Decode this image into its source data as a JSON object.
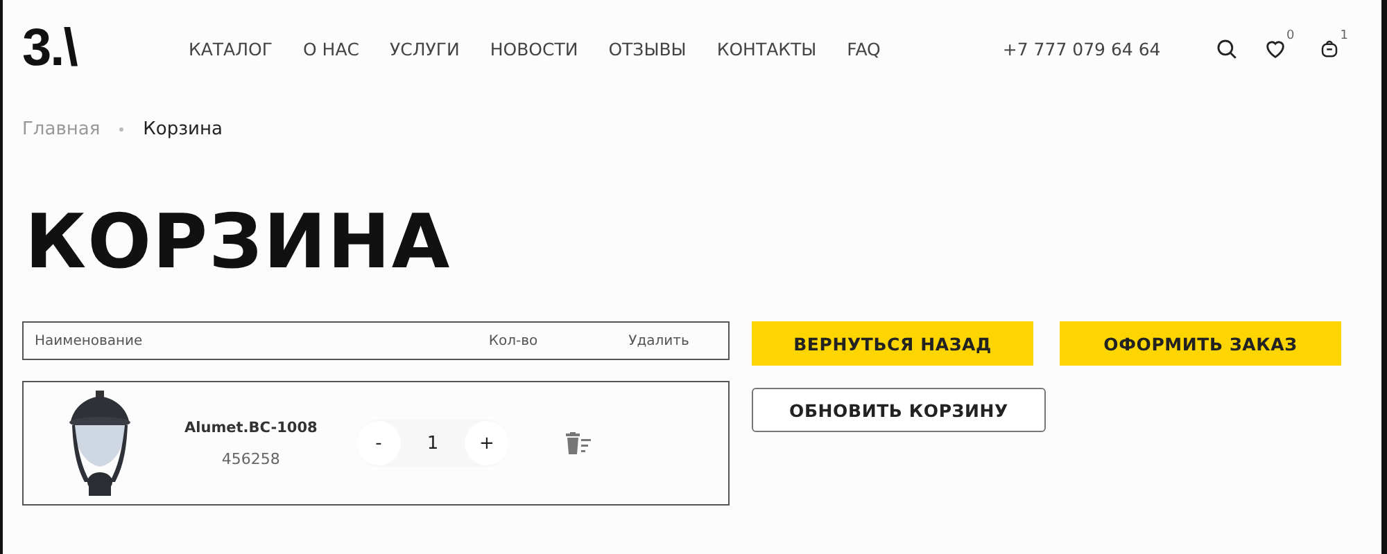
{
  "header": {
    "logo": "3.\\",
    "nav": [
      "КАТАЛОГ",
      "О НАС",
      "УСЛУГИ",
      "НОВОСТИ",
      "ОТЗЫВЫ",
      "КОНТАКТЫ",
      "FAQ"
    ],
    "phone": "+7 777 079 64 64",
    "favorites_count": "0",
    "cart_count": "1"
  },
  "breadcrumbs": [
    "Главная",
    "Корзина"
  ],
  "title": "КОРЗИНА",
  "table": {
    "columns": [
      "Наименование",
      "Кол-во",
      "Удалить"
    ],
    "rows": [
      {
        "name": "Alumet.BC-1008",
        "sku": "456258",
        "minus": "-",
        "quantity": "1",
        "plus": "+"
      }
    ]
  },
  "buttons": [
    {
      "label": "ВЕРНУТЬСЯ НАЗАД",
      "kind": "primary"
    },
    {
      "label": "ОФОРМИТЬ ЗАКАЗ",
      "kind": "primary"
    },
    {
      "label": "ОБНОВИТЬ КОРЗИНУ",
      "kind": "outline"
    }
  ]
}
